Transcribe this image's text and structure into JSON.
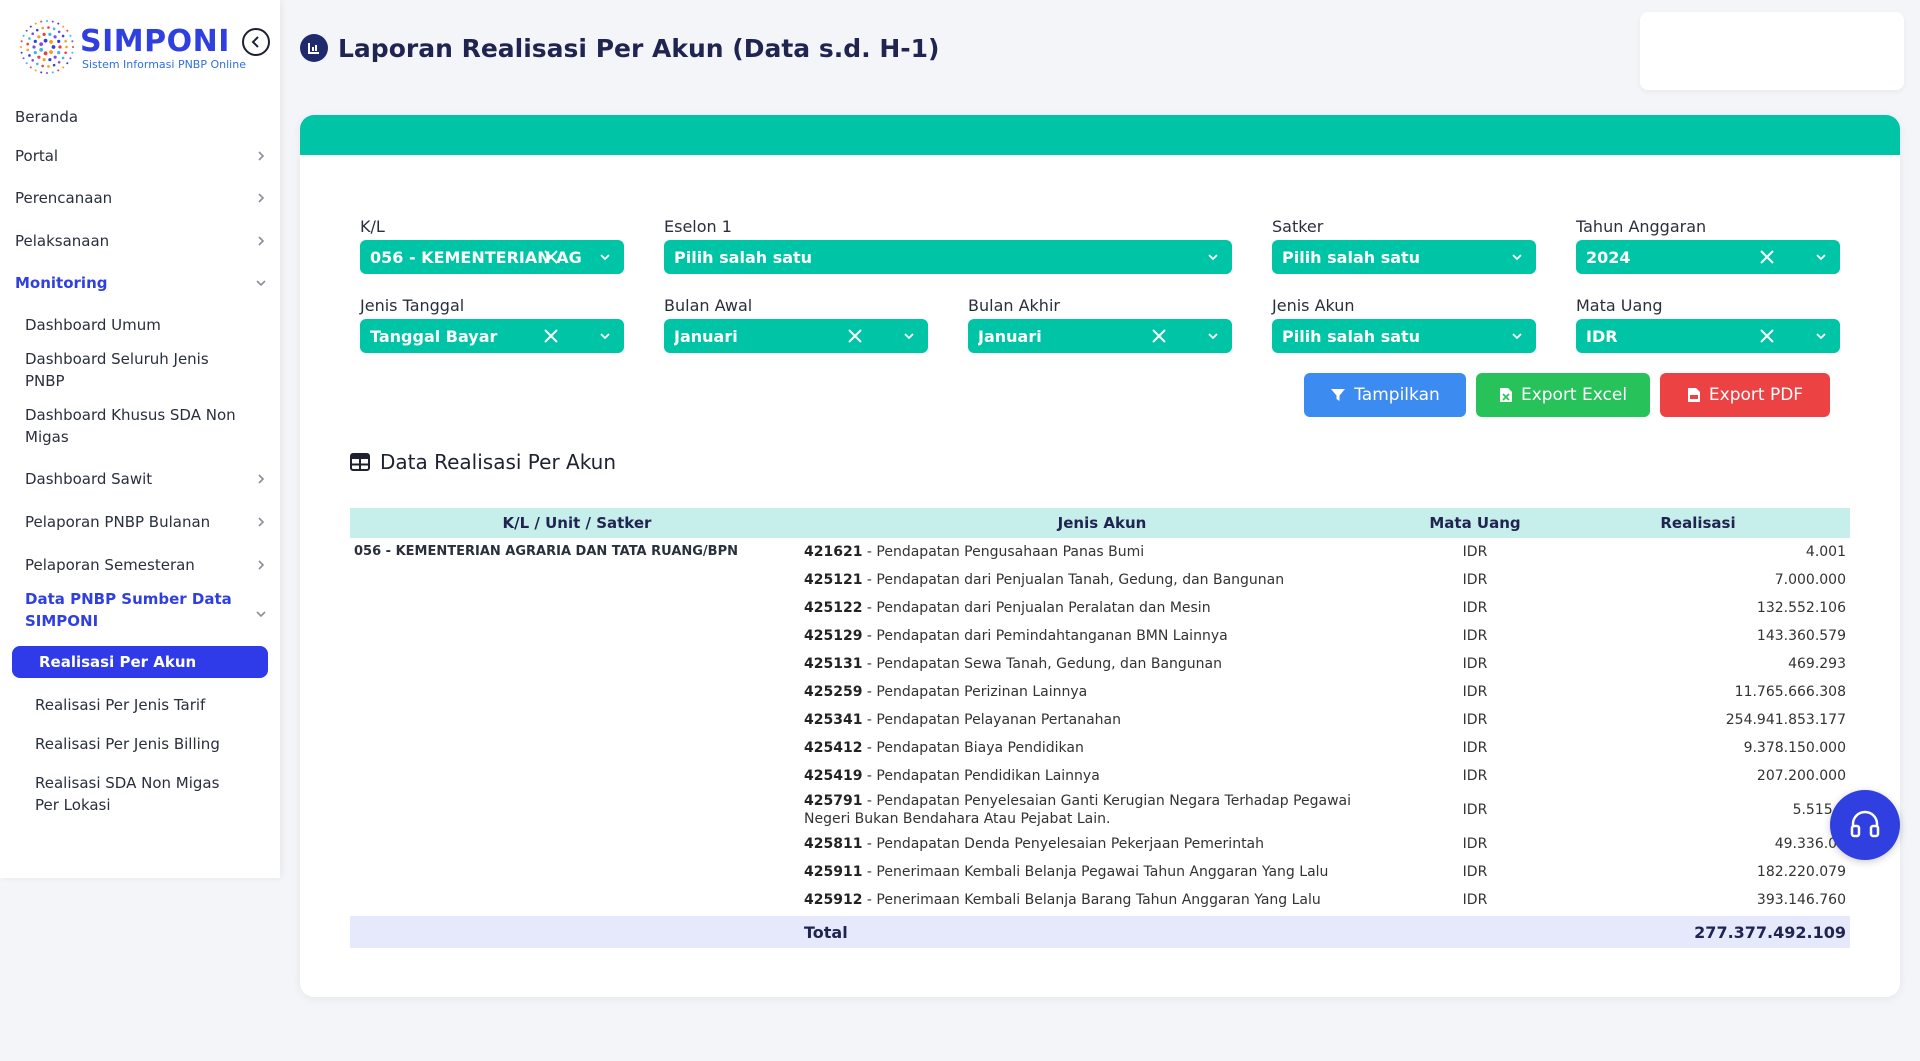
{
  "brand": {
    "name": "SIMPONI",
    "subtitle": "Sistem Informasi PNBP Online"
  },
  "sidebar": {
    "items": [
      {
        "label": "Beranda",
        "level": 0,
        "chevron": false
      },
      {
        "label": "Portal",
        "level": 0,
        "chevron": true
      },
      {
        "label": "Perencanaan",
        "level": 0,
        "chevron": true
      },
      {
        "label": "Pelaksanaan",
        "level": 0,
        "chevron": true
      },
      {
        "label": "Monitoring",
        "level": 0,
        "chevron": true,
        "expanded": true
      },
      {
        "label": "Dashboard Umum",
        "level": 1,
        "chevron": false
      },
      {
        "label": "Dashboard Seluruh Jenis PNBP",
        "level": 1,
        "chevron": false
      },
      {
        "label": "Dashboard Khusus SDA Non Migas",
        "level": 1,
        "chevron": false
      },
      {
        "label": "Dashboard Sawit",
        "level": 1,
        "chevron": true
      },
      {
        "label": "Pelaporan PNBP Bulanan",
        "level": 1,
        "chevron": true
      },
      {
        "label": "Pelaporan Semesteran",
        "level": 1,
        "chevron": true
      },
      {
        "label": "Data PNBP Sumber Data SIMPONI",
        "level": 1,
        "chevron": true,
        "expanded": true
      },
      {
        "label": "Realisasi Per Akun",
        "level": 2,
        "current": true
      },
      {
        "label": "Realisasi Per Jenis Tarif",
        "level": 2
      },
      {
        "label": "Realisasi Per Jenis Billing",
        "level": 2
      },
      {
        "label": "Realisasi SDA Non Migas Per Lokasi",
        "level": 2
      }
    ]
  },
  "header": {
    "title": "Laporan Realisasi Per Akun (Data s.d. H-1)"
  },
  "filters": {
    "kl": {
      "label": "K/L",
      "value": "056 - KEMENTERIAN AG"
    },
    "eselon1": {
      "label": "Eselon 1",
      "value": "Pilih salah satu"
    },
    "satker": {
      "label": "Satker",
      "value": "Pilih salah satu"
    },
    "tahun": {
      "label": "Tahun Anggaran",
      "value": "2024"
    },
    "jenis_tanggal": {
      "label": "Jenis Tanggal",
      "value": "Tanggal Bayar"
    },
    "bulan_awal": {
      "label": "Bulan Awal",
      "value": "Januari"
    },
    "bulan_akhir": {
      "label": "Bulan Akhir",
      "value": "Januari"
    },
    "jenis_akun": {
      "label": "Jenis Akun",
      "value": "Pilih salah satu"
    },
    "mata_uang": {
      "label": "Mata Uang",
      "value": "IDR"
    }
  },
  "actions": {
    "show_label": "Tampilkan",
    "excel_label": "Export Excel",
    "pdf_label": "Export PDF"
  },
  "section": {
    "title": "Data Realisasi Per Akun"
  },
  "table": {
    "headers": [
      "K/L / Unit / Satker",
      "Jenis Akun",
      "Mata Uang",
      "Realisasi"
    ],
    "kl_name": "056 - KEMENTERIAN AGRARIA DAN TATA RUANG/BPN",
    "rows": [
      {
        "code": "421621",
        "name": " - Pendapatan Pengusahaan Panas Bumi",
        "currency": "IDR",
        "amount": "4.001"
      },
      {
        "code": "425121",
        "name": " - Pendapatan dari Penjualan Tanah, Gedung, dan Bangunan",
        "currency": "IDR",
        "amount": "7.000.000"
      },
      {
        "code": "425122",
        "name": " - Pendapatan dari Penjualan Peralatan dan Mesin",
        "currency": "IDR",
        "amount": "132.552.106"
      },
      {
        "code": "425129",
        "name": " - Pendapatan dari Pemindahtanganan BMN Lainnya",
        "currency": "IDR",
        "amount": "143.360.579"
      },
      {
        "code": "425131",
        "name": " - Pendapatan Sewa Tanah, Gedung, dan Bangunan",
        "currency": "IDR",
        "amount": "469.293"
      },
      {
        "code": "425259",
        "name": " - Pendapatan Perizinan Lainnya",
        "currency": "IDR",
        "amount": "11.765.666.308"
      },
      {
        "code": "425341",
        "name": " - Pendapatan Pelayanan Pertanahan",
        "currency": "IDR",
        "amount": "254.941.853.177"
      },
      {
        "code": "425412",
        "name": " - Pendapatan Biaya Pendidikan",
        "currency": "IDR",
        "amount": "9.378.150.000"
      },
      {
        "code": "425419",
        "name": " - Pendapatan Pendidikan Lainnya",
        "currency": "IDR",
        "amount": "207.200.000"
      },
      {
        "code": "425791",
        "name": " - Pendapatan Penyelesaian Ganti Kerugian Negara Terhadap Pegawai Negeri Bukan Bendahara Atau Pejabat Lain.",
        "currency": "IDR",
        "amount": "5.515.6"
      },
      {
        "code": "425811",
        "name": " - Pendapatan Denda Penyelesaian Pekerjaan Pemerintah",
        "currency": "IDR",
        "amount": "49.336.07"
      },
      {
        "code": "425911",
        "name": " - Penerimaan Kembali Belanja Pegawai Tahun Anggaran Yang Lalu",
        "currency": "IDR",
        "amount": "182.220.079"
      },
      {
        "code": "425912",
        "name": " - Penerimaan Kembali Belanja Barang Tahun Anggaran Yang Lalu",
        "currency": "IDR",
        "amount": "393.146.760"
      }
    ],
    "total_label": "Total",
    "total_amount": "277.377.492.109"
  },
  "colors": {
    "accent": "#00c4a6",
    "brand": "#2f3fe0",
    "btn_show": "#3b8bf0",
    "btn_excel": "#27c25a",
    "btn_pdf": "#ec4244"
  }
}
